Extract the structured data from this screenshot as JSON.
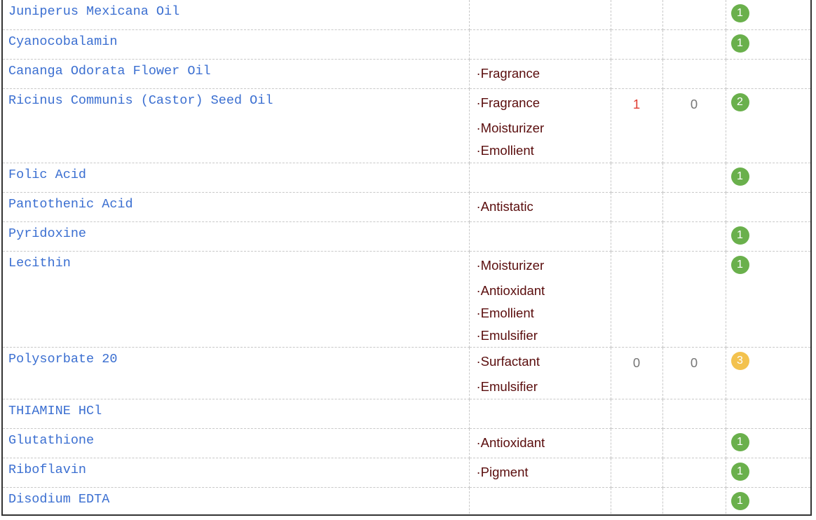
{
  "colors": {
    "name": "#3b6fd1",
    "function": "#5a0d0d",
    "score_high": "#e03c31",
    "score_low": "#777777",
    "badge_green": "#6ab04c",
    "badge_yellow": "#f3c24e"
  },
  "ingredients": [
    {
      "name": "Juniperus Mexicana Oil",
      "functions": [],
      "s1": "",
      "s2": "",
      "rating": "1",
      "rating_color": "green"
    },
    {
      "name": "Cyanocobalamin",
      "functions": [],
      "s1": "",
      "s2": "",
      "rating": "1",
      "rating_color": "green"
    },
    {
      "name": "Cananga Odorata Flower Oil",
      "functions": [
        "·Fragrance"
      ],
      "s1": "",
      "s2": "",
      "rating": "",
      "rating_color": ""
    },
    {
      "name": "Ricinus Communis (Castor) Seed Oil",
      "functions": [
        "·Fragrance",
        "·Moisturizer",
        "·Emollient"
      ],
      "s1": "1",
      "s2": "0",
      "rating": "2",
      "rating_color": "green"
    },
    {
      "name": "Folic Acid",
      "functions": [],
      "s1": "",
      "s2": "",
      "rating": "1",
      "rating_color": "green"
    },
    {
      "name": "Pantothenic Acid",
      "functions": [
        "·Antistatic"
      ],
      "s1": "",
      "s2": "",
      "rating": "",
      "rating_color": ""
    },
    {
      "name": "Pyridoxine",
      "functions": [],
      "s1": "",
      "s2": "",
      "rating": "1",
      "rating_color": "green"
    },
    {
      "name": "Lecithin",
      "functions": [
        "·Moisturizer",
        "·Antioxidant",
        "·Emollient",
        "·Emulsifier"
      ],
      "s1": "",
      "s2": "",
      "rating": "1",
      "rating_color": "green"
    },
    {
      "name": "Polysorbate 20",
      "functions": [
        "·Surfactant",
        "·Emulsifier"
      ],
      "s1": "0",
      "s2": "0",
      "rating": "3",
      "rating_color": "yellow"
    },
    {
      "name": "THIAMINE HCl",
      "functions": [],
      "s1": "",
      "s2": "",
      "rating": "",
      "rating_color": ""
    },
    {
      "name": "Glutathione",
      "functions": [
        "·Antioxidant"
      ],
      "s1": "",
      "s2": "",
      "rating": "1",
      "rating_color": "green"
    },
    {
      "name": "Riboflavin",
      "functions": [
        "·Pigment"
      ],
      "s1": "",
      "s2": "",
      "rating": "1",
      "rating_color": "green"
    },
    {
      "name": "Disodium EDTA",
      "functions": [],
      "s1": "",
      "s2": "",
      "rating": "1",
      "rating_color": "green"
    }
  ]
}
